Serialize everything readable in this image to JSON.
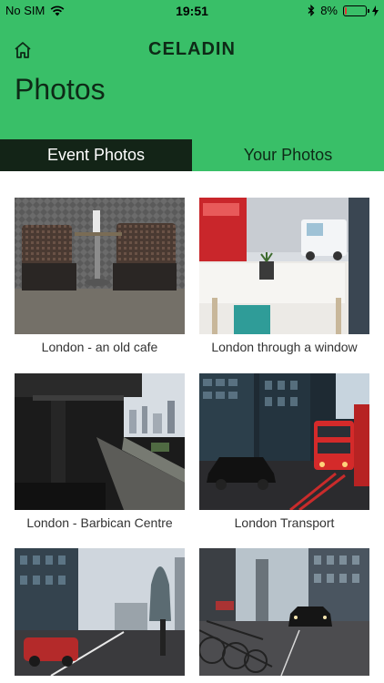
{
  "status_bar": {
    "carrier": "No SIM",
    "time": "19:51",
    "battery_percent": "8%",
    "battery_level": 0.08,
    "battery_color": "#e53935",
    "icons": [
      "wifi-icon",
      "bluetooth-icon",
      "battery-icon",
      "charging-icon"
    ]
  },
  "header": {
    "brand": "CELADIN",
    "title": "Photos",
    "home_icon": "home-icon",
    "background": "#39bf68"
  },
  "tabs": [
    {
      "label": "Event Photos",
      "active": true
    },
    {
      "label": "Your Photos",
      "active": false
    }
  ],
  "photos": [
    {
      "caption": "London - an old cafe"
    },
    {
      "caption": "London through a window"
    },
    {
      "caption": "London - Barbican Centre"
    },
    {
      "caption": "London Transport"
    },
    {
      "caption": ""
    },
    {
      "caption": ""
    }
  ]
}
